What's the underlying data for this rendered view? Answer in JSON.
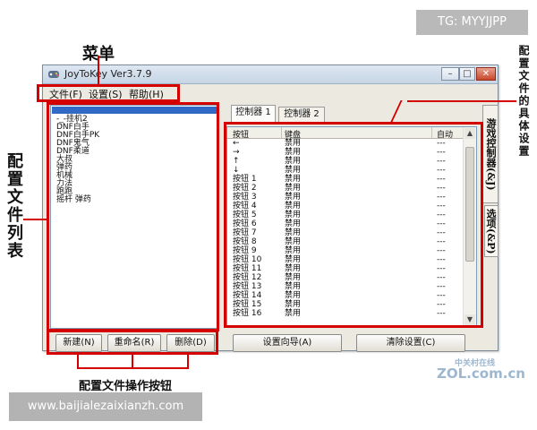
{
  "window": {
    "title": "JoyToKey Ver3.7.9",
    "controls": {
      "minimize": "–",
      "maximize": "□",
      "close": "✕"
    }
  },
  "menu": {
    "items": [
      "文件(F)",
      "设置(S)",
      "帮助(H)"
    ]
  },
  "profiles": [
    "-_-挂机2",
    "DNF白手",
    "DNF白手PK",
    "DNF鬼气",
    "DNF柔道",
    "大叔",
    "弹药",
    "机械",
    "力法",
    "跑跑",
    "摇杆 弹药"
  ],
  "profile_buttons": {
    "new": "新建(N)",
    "rename": "重命名(R)",
    "delete": "删除(D)"
  },
  "tabs": [
    "控制器 1",
    "控制器 2"
  ],
  "grid": {
    "headers": [
      "按钮",
      "键盘",
      "自动"
    ],
    "rows": [
      [
        "←",
        "禁用",
        "---"
      ],
      [
        "→",
        "禁用",
        "---"
      ],
      [
        "↑",
        "禁用",
        "---"
      ],
      [
        "↓",
        "禁用",
        "---"
      ],
      [
        "按钮 1",
        "禁用",
        "---"
      ],
      [
        "按钮 2",
        "禁用",
        "---"
      ],
      [
        "按钮 3",
        "禁用",
        "---"
      ],
      [
        "按钮 4",
        "禁用",
        "---"
      ],
      [
        "按钮 5",
        "禁用",
        "---"
      ],
      [
        "按钮 6",
        "禁用",
        "---"
      ],
      [
        "按钮 7",
        "禁用",
        "---"
      ],
      [
        "按钮 8",
        "禁用",
        "---"
      ],
      [
        "按钮 9",
        "禁用",
        "---"
      ],
      [
        "按钮 10",
        "禁用",
        "---"
      ],
      [
        "按钮 11",
        "禁用",
        "---"
      ],
      [
        "按钮 12",
        "禁用",
        "---"
      ],
      [
        "按钮 13",
        "禁用",
        "---"
      ],
      [
        "按钮 14",
        "禁用",
        "---"
      ],
      [
        "按钮 15",
        "禁用",
        "---"
      ],
      [
        "按钮 16",
        "禁用",
        "---"
      ]
    ]
  },
  "bottom_buttons": {
    "wizard": "设置向导(A)",
    "clear": "清除设置(C)"
  },
  "side_tabs": {
    "game": "游戏控制器(&J)",
    "options": "选项(&P)"
  },
  "annotations": {
    "menu": "菜单",
    "profile_list": "配置文件列表",
    "profile_ops": "配置文件操作按钮",
    "details": "配置文件的具体设置"
  },
  "overlays": {
    "tg": "TG: MYYJJPP",
    "site": "www.baijialezaixianzh.com",
    "watermark_cn": "中关村在线",
    "watermark_en": "ZOL.com.cn"
  },
  "colors": {
    "annotation_red": "#d40000",
    "selection_blue": "#3169c6"
  }
}
